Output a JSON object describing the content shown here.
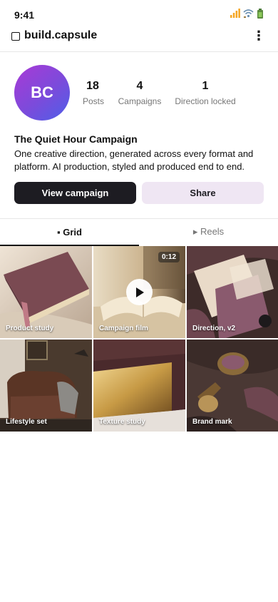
{
  "status": {
    "time": "9:41",
    "icons": [
      "signal-icon",
      "wifi-icon",
      "battery-icon"
    ]
  },
  "header": {
    "handle": "build.capsule",
    "more_icon": "⋮"
  },
  "profile": {
    "avatar_initials": "BC",
    "stats": [
      {
        "value": "18",
        "label": "Posts"
      },
      {
        "value": "4",
        "label": "Campaigns"
      },
      {
        "value": "1",
        "label": "Direction locked"
      }
    ],
    "bio_title": "The Quiet Hour Campaign",
    "bio_text": "One creative direction, generated across every format and platform. AI production, styled and produced end to end."
  },
  "actions": {
    "primary": "View campaign",
    "secondary": "Share"
  },
  "tabs": [
    {
      "label": "▪ Grid",
      "active": true
    },
    {
      "label": "▸ Reels",
      "active": false
    }
  ],
  "grid": [
    {
      "label": "Product study"
    },
    {
      "label": "Campaign film",
      "duration": "0:12",
      "video": true
    },
    {
      "label": "Direction, v2"
    },
    {
      "label": "Lifestyle set"
    },
    {
      "label": "Texture study"
    },
    {
      "label": "Brand mark"
    }
  ],
  "colors": {
    "primary_button": "#1d1c22",
    "secondary_button": "#efe6f3",
    "accent_plum": "#8a5a6e"
  }
}
